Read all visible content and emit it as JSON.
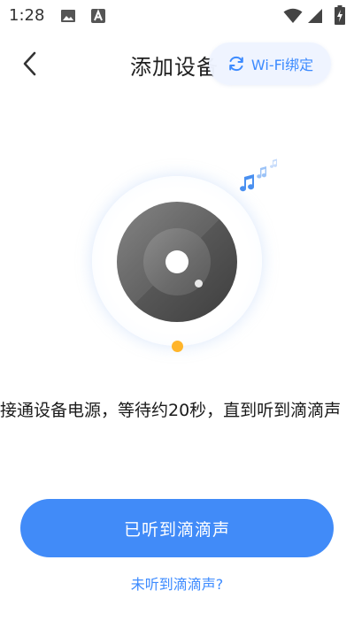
{
  "status_bar": {
    "time": "1:28",
    "icons": [
      "image-icon",
      "font-download-icon",
      "wifi-icon",
      "signal-icon",
      "battery-charging-icon"
    ]
  },
  "header": {
    "back_icon": "chevron-left-icon",
    "title": "添加设备",
    "wifi_bind": {
      "icon": "refresh-icon",
      "label": "Wi-Fi绑定"
    }
  },
  "illustration": {
    "icons": [
      "speaker-disc-icon",
      "music-note-icon"
    ],
    "colors": {
      "disc": "#595959",
      "indicator": "#ffb52b",
      "accent": "#418bf8"
    }
  },
  "instruction": "接通设备电源，等待约20秒，直到听到滴滴声",
  "primary_button": {
    "label": "已听到滴滴声"
  },
  "secondary_link": {
    "label": "未听到滴滴声?"
  }
}
